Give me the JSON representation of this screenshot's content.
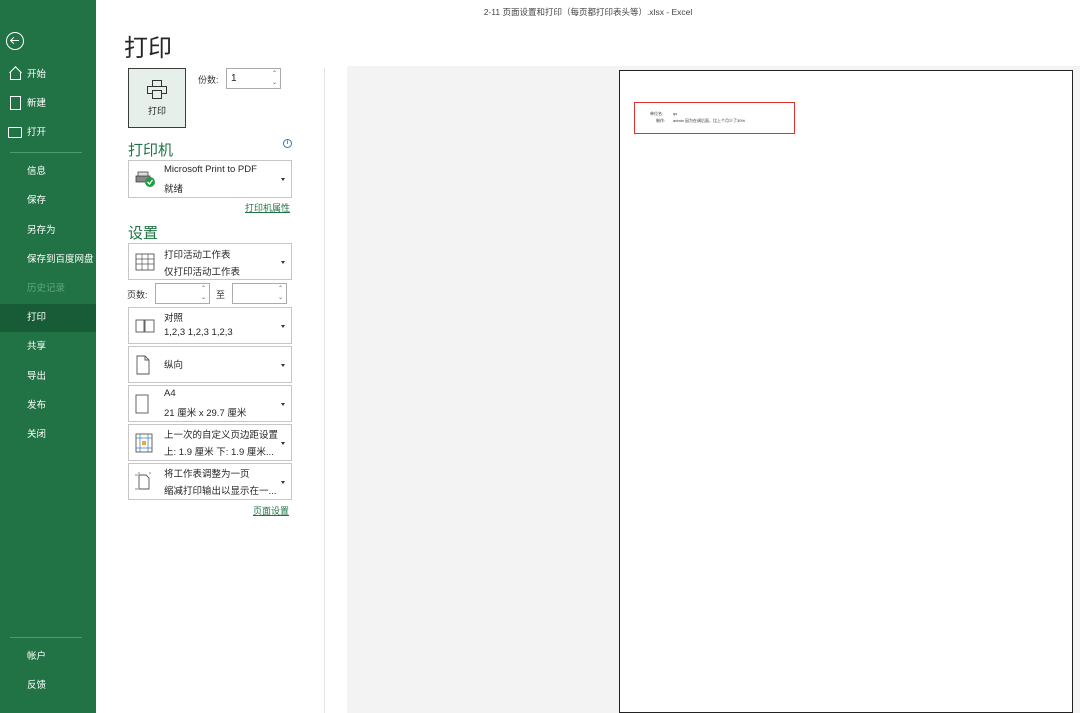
{
  "window": {
    "title": "2-11 页面设置和打印（每页都打印表头等）.xlsx  -  Excel"
  },
  "sidebar": {
    "top_items": [
      {
        "label": "开始",
        "icon": "home-icon"
      },
      {
        "label": "新建",
        "icon": "new-file-icon"
      },
      {
        "label": "打开",
        "icon": "open-folder-icon"
      }
    ],
    "items": [
      {
        "label": "信息"
      },
      {
        "label": "保存"
      },
      {
        "label": "另存为"
      },
      {
        "label": "保存到百度网盘"
      },
      {
        "label": "历史记录"
      },
      {
        "label": "打印"
      },
      {
        "label": "共享"
      },
      {
        "label": "导出"
      },
      {
        "label": "发布"
      },
      {
        "label": "关闭"
      }
    ],
    "bottom_items": [
      {
        "label": "帐户"
      },
      {
        "label": "反馈"
      }
    ],
    "active": "打印",
    "colors": {
      "background": "#217346",
      "active": "#185c37"
    }
  },
  "main": {
    "title": "打印",
    "print_button_label": "打印",
    "copies": {
      "label": "份数:",
      "value": "1"
    },
    "printer": {
      "section_title": "打印机",
      "name": "Microsoft Print to PDF",
      "status": "就绪",
      "properties_link": "打印机属性"
    },
    "settings": {
      "section_title": "设置",
      "what_to_print": {
        "line1": "打印活动工作表",
        "line2": "仅打印活动工作表"
      },
      "pages": {
        "label": "页数:",
        "from": "",
        "to_label": "至",
        "to": ""
      },
      "collation": {
        "line1": "对照",
        "line2": "1,2,3    1,2,3    1,2,3"
      },
      "orientation": {
        "line1": "纵向"
      },
      "paper": {
        "line1": "A4",
        "line2": "21 厘米 x 29.7 厘米"
      },
      "margins": {
        "line1": "上一次的自定义页边距设置",
        "line2": "上: 1.9 厘米 下: 1.9 厘米..."
      },
      "scaling": {
        "line1": "将工作表调整为一页",
        "line2": "缩减打印输出以显示在一..."
      },
      "page_setup_link": "页面设置"
    }
  },
  "preview": {
    "header_line1_label": "单位名:",
    "header_line1_value": "qs",
    "header_line2_label": "制作:",
    "header_line2_value": "admin 因为在调后面，比上个月少了30%",
    "highlight_color": "#e03030"
  }
}
